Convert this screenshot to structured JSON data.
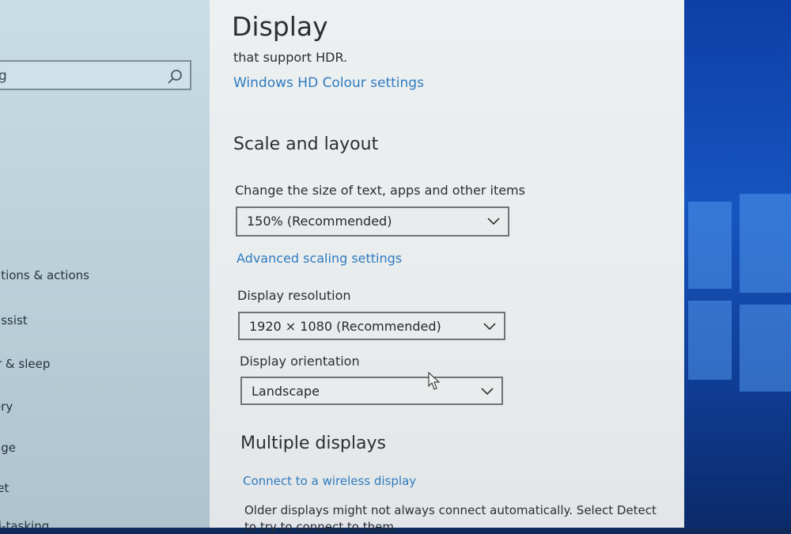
{
  "nav": {
    "search_text": "g",
    "items": [
      "ations & actions",
      "assist",
      "r & sleep",
      "ery",
      "age",
      "let",
      "ti-tasking"
    ]
  },
  "main": {
    "title": "Display",
    "hdr_note": "that support HDR.",
    "hdr_link": "Windows HD Colour settings",
    "scale_section": "Scale and layout",
    "scale_label": "Change the size of text, apps and other items",
    "scale_value": "150% (Recommended)",
    "advanced_link": "Advanced scaling settings",
    "resolution_label": "Display resolution",
    "resolution_value": "1920 × 1080 (Recommended)",
    "orientation_label": "Display orientation",
    "orientation_value": "Landscape",
    "multiple_section": "Multiple displays",
    "wireless_link": "Connect to a wireless display",
    "older_note": "Older displays might not always connect automatically. Select Detect",
    "older_note_2": "to try to connect to them."
  },
  "colors": {
    "link": "#2f7bbf",
    "wallpaper": "#1655c0"
  }
}
